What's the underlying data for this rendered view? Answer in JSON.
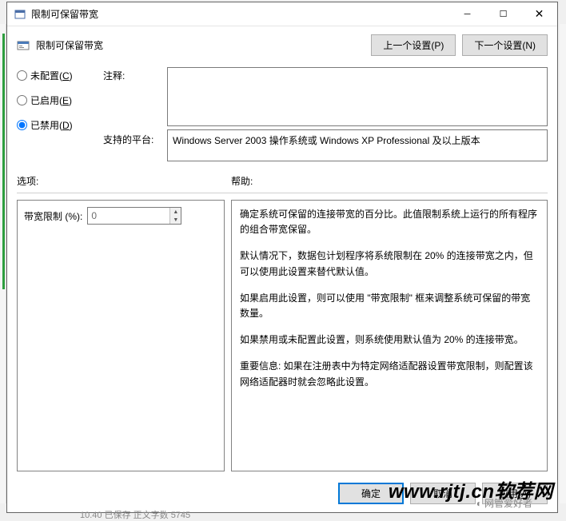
{
  "window": {
    "title": "限制可保留带宽"
  },
  "header": {
    "title": "限制可保留带宽",
    "prev_btn": "上一个设置(P)",
    "next_btn": "下一个设置(N)"
  },
  "radios": {
    "not_configured": "未配置(C)",
    "enabled": "已启用(E)",
    "disabled": "已禁用(D)",
    "selected": "disabled"
  },
  "labels": {
    "comment": "注释:",
    "platform": "支持的平台:",
    "options": "选项:",
    "help": "帮助:"
  },
  "fields": {
    "comment_value": "",
    "platform_value": "Windows Server 2003 操作系统或 Windows XP Professional 及以上版本"
  },
  "options": {
    "bandwidth_label": "带宽限制 (%):",
    "bandwidth_value": "0"
  },
  "help_text": {
    "p1": "确定系统可保留的连接带宽的百分比。此值限制系统上运行的所有程序的组合带宽保留。",
    "p2": "默认情况下，数据包计划程序将系统限制在 20% 的连接带宽之内，但可以使用此设置来替代默认值。",
    "p3": "如果启用此设置，则可以使用 \"带宽限制\" 框来调整系统可保留的带宽数量。",
    "p4": "如果禁用或未配置此设置，则系统使用默认值为 20% 的连接带宽。",
    "p5": "重要信息: 如果在注册表中为特定网络适配器设置带宽限制，则配置该网络适配器时就会忽略此设置。"
  },
  "footer": {
    "ok": "确定",
    "cancel": "取消",
    "apply": "应用(A)"
  },
  "watermark": "www.rjtj.cn软荐网",
  "watermark2": "网管爱好者",
  "bottom_frag": "10.40  已保存  正文字数  5745"
}
